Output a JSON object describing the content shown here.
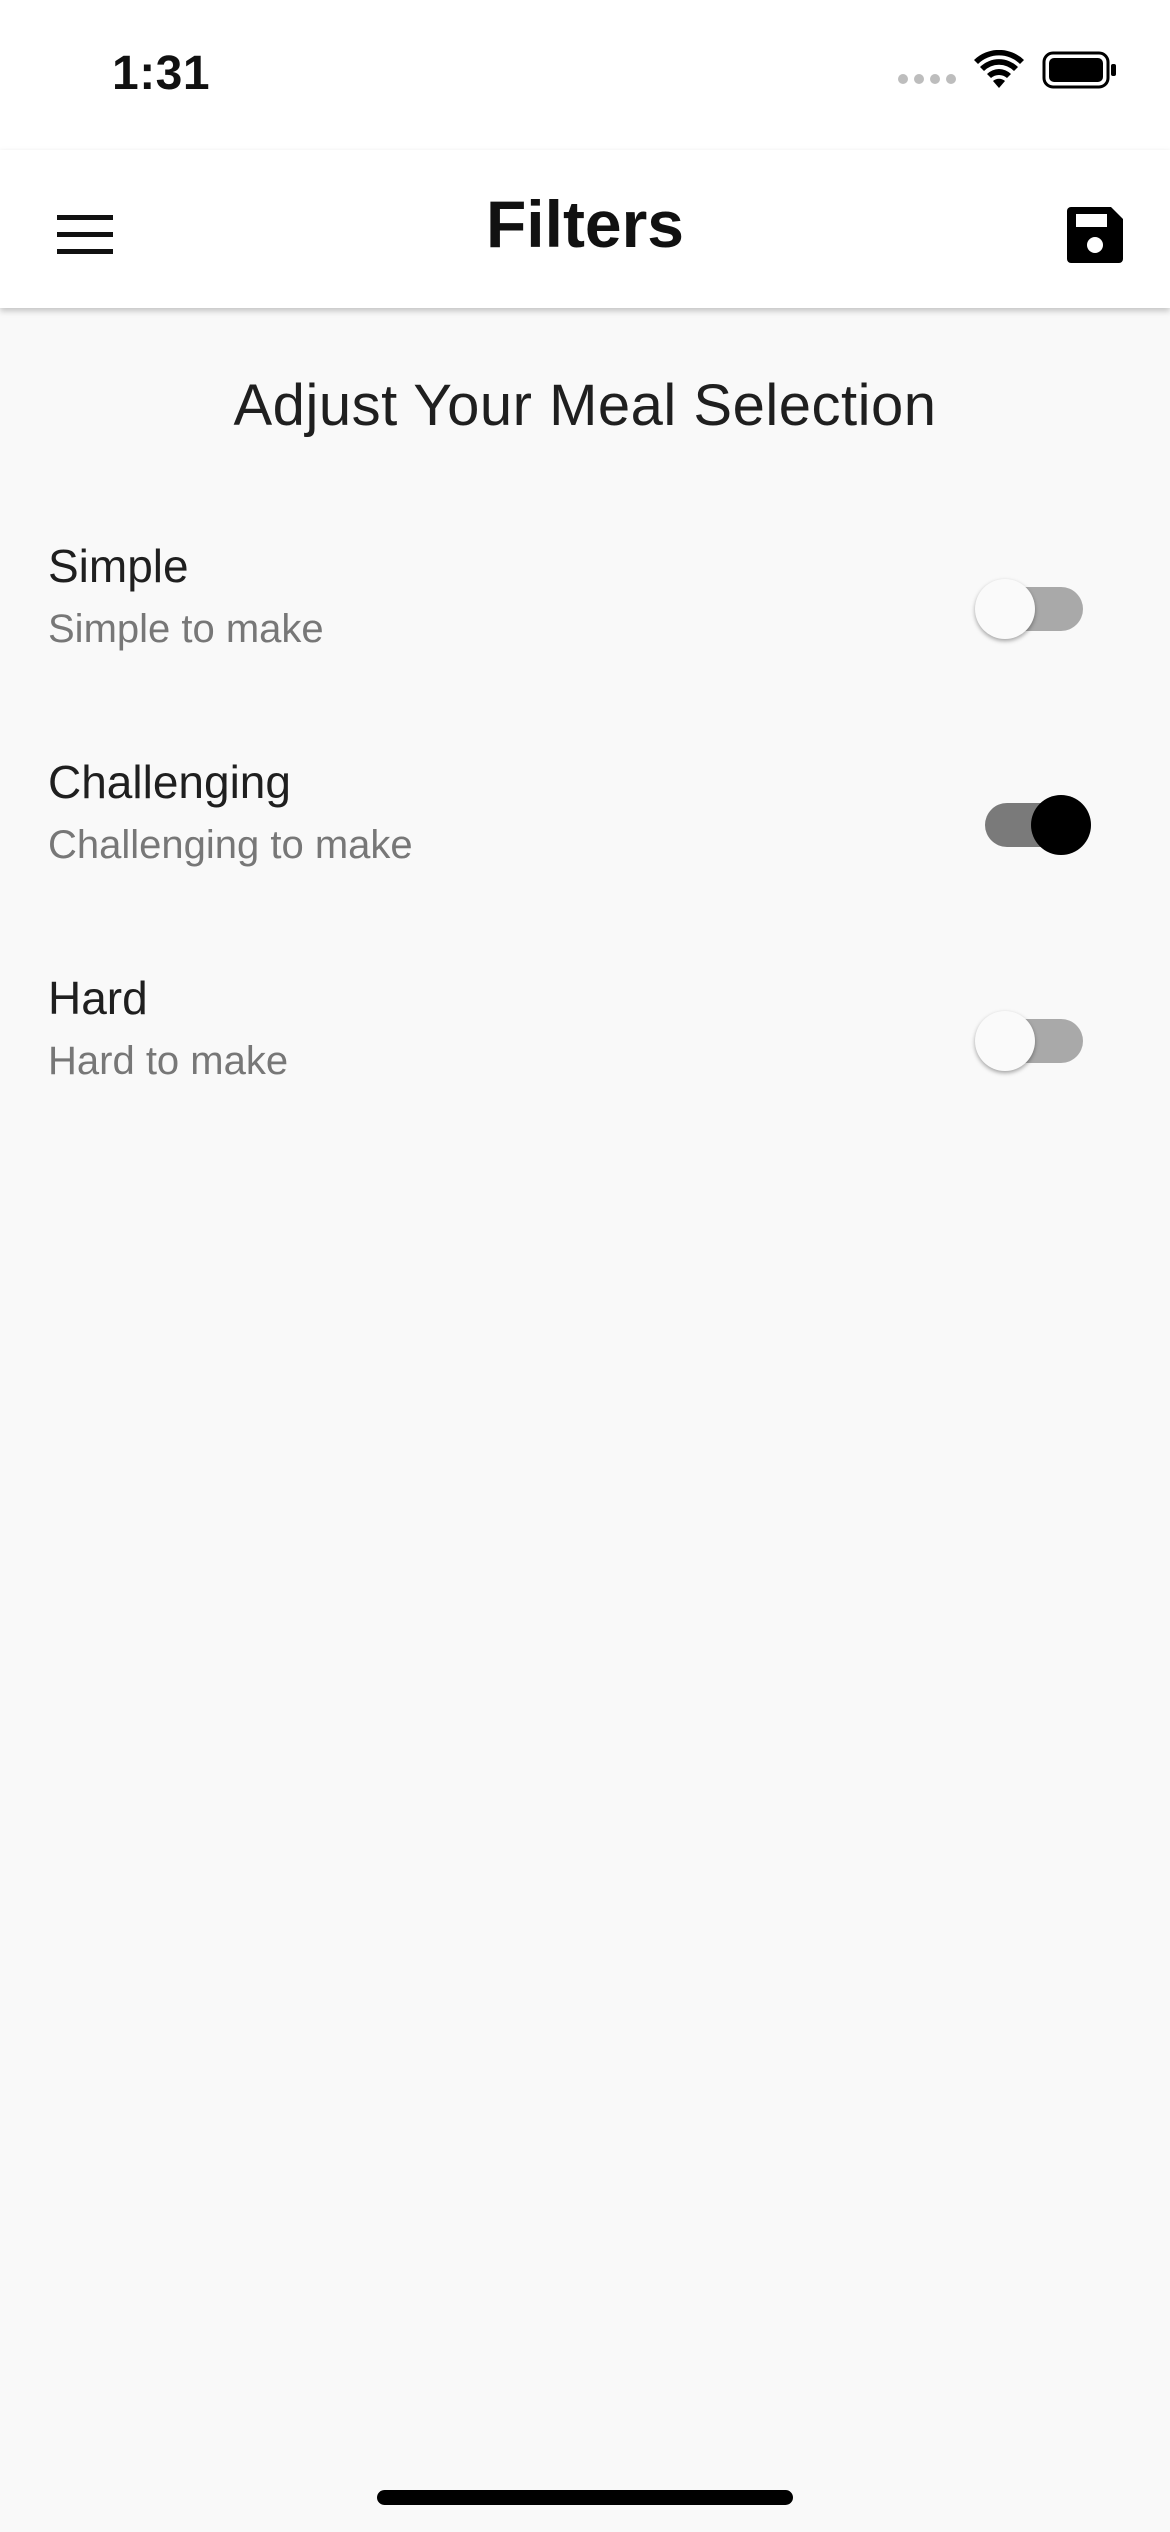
{
  "status_bar": {
    "time": "1:31",
    "icons": [
      "signal-icon",
      "wifi-icon",
      "battery-icon"
    ]
  },
  "app_bar": {
    "title": "Filters",
    "menu_icon": "menu-icon",
    "save_icon": "save-icon"
  },
  "main": {
    "heading": "Adjust Your Meal Selection",
    "filters": [
      {
        "title": "Simple",
        "subtitle": "Simple to make",
        "enabled": false
      },
      {
        "title": "Challenging",
        "subtitle": "Challenging to make",
        "enabled": true
      },
      {
        "title": "Hard",
        "subtitle": "Hard to make",
        "enabled": false
      }
    ]
  },
  "colors": {
    "app_bar_background": "#ffffff",
    "page_background": "#f9f9f9",
    "switch_on_thumb": "#000000",
    "switch_on_track": "#7a7a7a",
    "switch_off_thumb": "#fafafa",
    "switch_off_track": "#a9a9a9",
    "subtitle_text": "#777777"
  }
}
